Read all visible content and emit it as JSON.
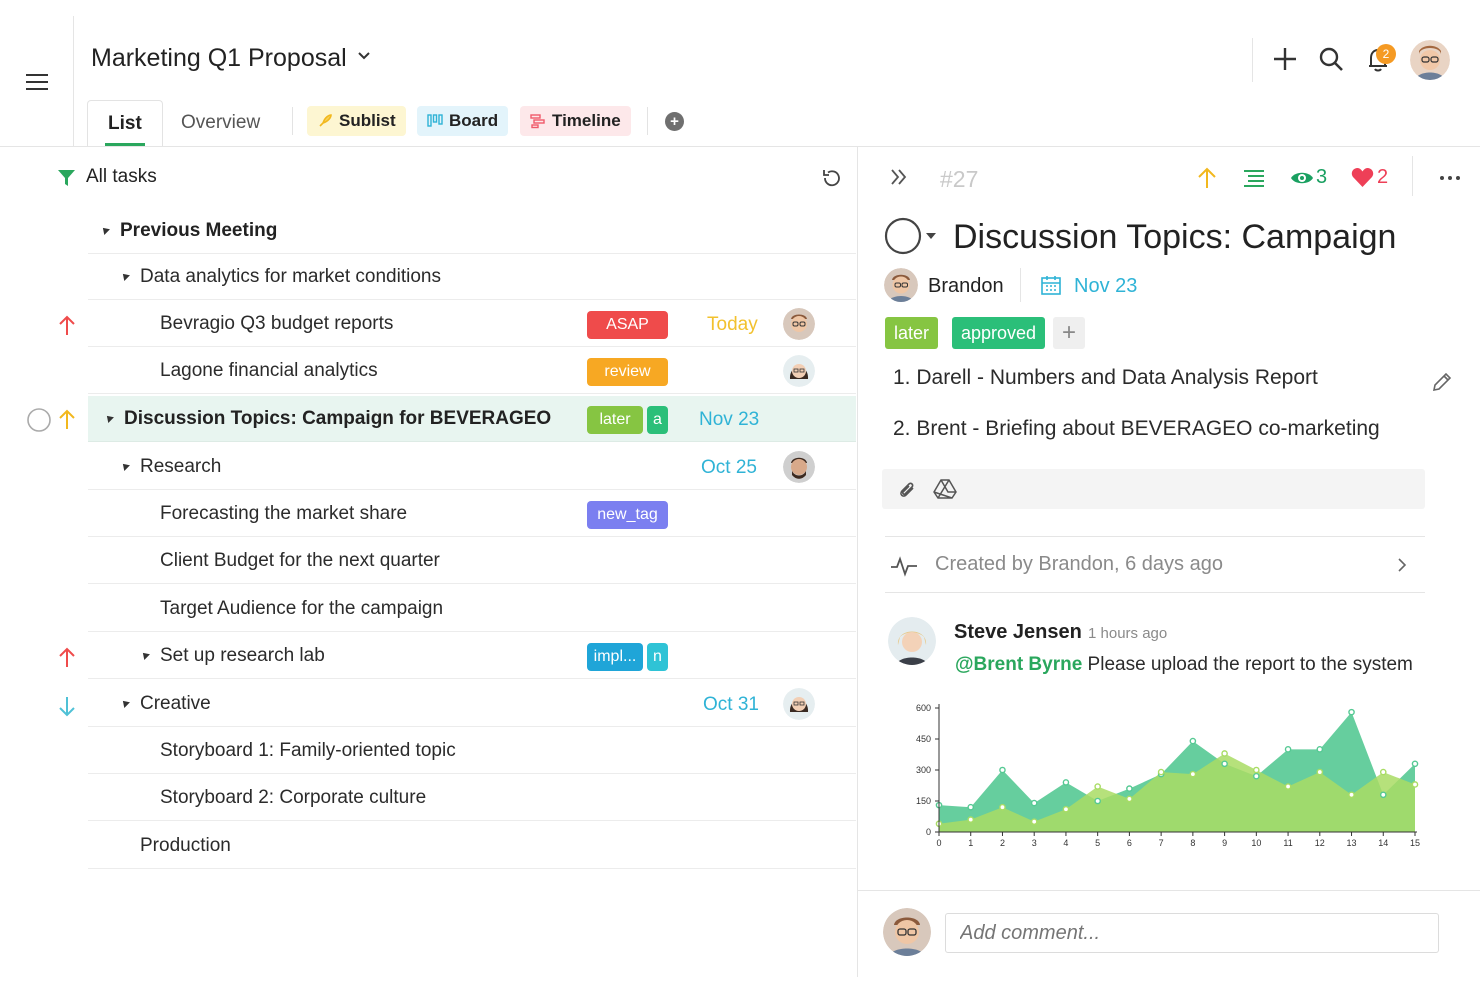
{
  "header": {
    "project_title": "Marketing Q1 Proposal",
    "tabs": {
      "list": "List",
      "overview": "Overview"
    },
    "views": {
      "sublist": "Sublist",
      "board": "Board",
      "timeline": "Timeline"
    },
    "notification_count": "2"
  },
  "filter": {
    "label": "All tasks"
  },
  "tasks": {
    "previous_meeting": "Previous Meeting",
    "data_analytics": "Data analytics for market conditions",
    "bevragio": {
      "label": "Bevragio Q3 budget reports",
      "tag": "ASAP",
      "date": "Today"
    },
    "lagone": {
      "label": "Lagone financial analytics",
      "tag": "review"
    },
    "discussion": {
      "label": "Discussion Topics: Campaign for BEVERAGEO",
      "tag1": "later",
      "tag2": "a",
      "date": "Nov 23"
    },
    "research": {
      "label": "Research",
      "date": "Oct 25"
    },
    "forecasting": {
      "label": "Forecasting the market share",
      "tag": "new_tag"
    },
    "client_budget": "Client Budget for the next quarter",
    "target_audience": "Target Audience for the campaign",
    "setup_lab": {
      "label": "Set up research lab",
      "tag1": "impl...",
      "tag2": "n"
    },
    "creative": {
      "label": "Creative",
      "date": "Oct 31"
    },
    "storyboard1": "Storyboard 1: Family-oriented topic",
    "storyboard2": "Storyboard 2: Corporate culture",
    "production": "Production"
  },
  "detail": {
    "task_number": "#27",
    "watchers": "3",
    "likes": "2",
    "title": "Discussion Topics: Campaign",
    "assignee": "Brandon",
    "due_date": "Nov 23",
    "tags": [
      "later",
      "approved"
    ],
    "description": [
      "1. Darell - Numbers and Data Analysis Report",
      "2. Brent - Briefing about BEVERAGEO co-marketing"
    ],
    "activity": "Created by Brandon, 6 days ago",
    "comment": {
      "author": "Steve Jensen",
      "time": "1 hours ago",
      "mention": "@Brent Byrne",
      "text": " Please upload the report to the system"
    },
    "comment_placeholder": "Add comment..."
  },
  "colors": {
    "accent_green": "#2aa75d",
    "asap": "#ef4b4b",
    "review": "#f7a823",
    "later": "#86c542",
    "new_tag": "#7b7ff0",
    "impl": "#1fa5d8",
    "date_blue": "#2fb3d6",
    "today_yellow": "#f2c12e"
  },
  "chart_data": {
    "type": "area",
    "x": [
      0,
      1,
      2,
      3,
      4,
      5,
      6,
      7,
      8,
      9,
      10,
      11,
      12,
      13,
      14,
      15
    ],
    "ylim": [
      0,
      600
    ],
    "yticks": [
      0,
      150,
      300,
      450,
      600
    ],
    "series": [
      {
        "color": "#55c993",
        "values": [
          130,
          120,
          300,
          140,
          240,
          150,
          210,
          280,
          440,
          330,
          270,
          400,
          400,
          580,
          180,
          330
        ]
      },
      {
        "color": "#a9dc64",
        "values": [
          40,
          60,
          120,
          50,
          110,
          220,
          160,
          290,
          280,
          380,
          300,
          220,
          290,
          180,
          290,
          230
        ]
      }
    ]
  }
}
